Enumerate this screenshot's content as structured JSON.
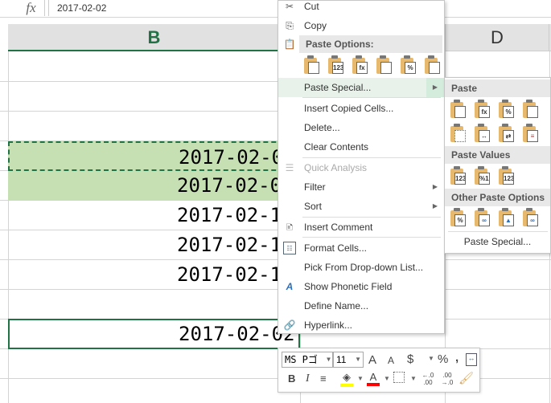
{
  "formula_bar": {
    "fx": "fx",
    "value": "2017-02-02"
  },
  "columns": {
    "b": "B",
    "d": "D"
  },
  "cells": [
    "2017-02-0",
    "2017-02-0",
    "2017-02-1",
    "2017-02-1",
    "2017-02-1",
    "",
    "2017-02-02"
  ],
  "context_menu": {
    "cut": "Cut",
    "copy": "Copy",
    "paste_options": "Paste Options:",
    "paste_icons": [
      "",
      "123",
      "fx",
      "",
      "%",
      ""
    ],
    "paste_special": "Paste Special...",
    "insert_copied": "Insert Copied Cells...",
    "delete": "Delete...",
    "clear": "Clear Contents",
    "quick_analysis": "Quick Analysis",
    "filter": "Filter",
    "sort": "Sort",
    "insert_comment": "Insert Comment",
    "format_cells": "Format Cells...",
    "pick_list": "Pick From Drop-down List...",
    "phonetic": "Show Phonetic Field",
    "define_name": "Define Name...",
    "hyperlink": "Hyperlink..."
  },
  "submenu": {
    "paste": "Paste",
    "paste_values": "Paste Values",
    "values_icons": [
      "123",
      "%123",
      "123"
    ],
    "other": "Other Paste Options",
    "paste_special": "Paste Special..."
  },
  "mini_toolbar": {
    "font": "MS Pゴ",
    "size": "11",
    "bold": "B",
    "italic": "I",
    "currency": "$",
    "percent": "%",
    "comma": ",",
    "inc_dec": "←.0 .00",
    "dec_dec": ".00 →.0",
    "font_color": "A",
    "grow": "A",
    "shrink": "A"
  },
  "colors": {
    "accent": "#217346",
    "selection_fill": "#c6e0b4",
    "highlight": "#ffff00",
    "font_color": "#ff0000"
  }
}
